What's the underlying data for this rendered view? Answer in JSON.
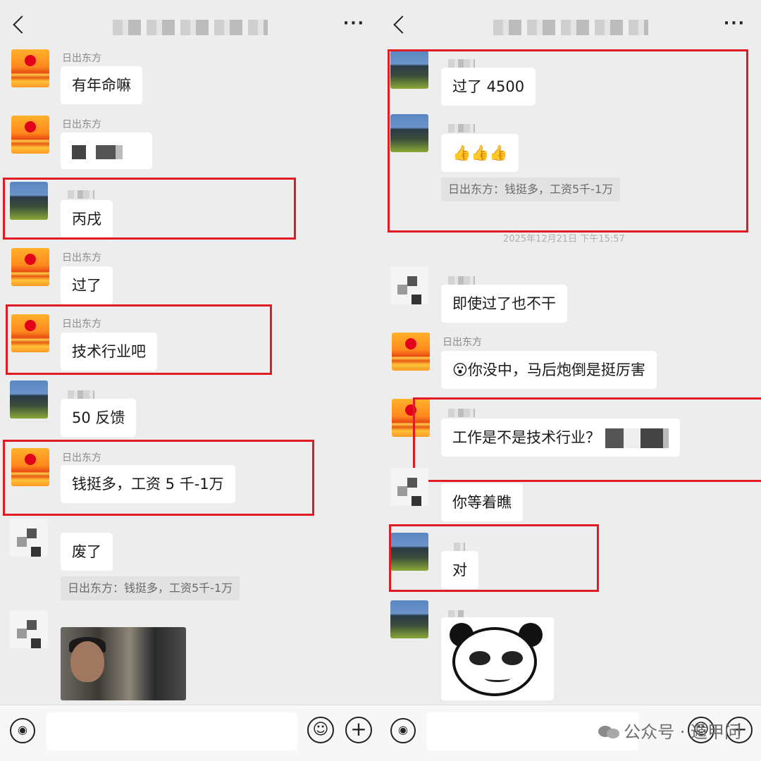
{
  "left_chat": {
    "messages": [
      {
        "sender": "日出东方",
        "text": "有年命嘛"
      },
      {
        "sender": "日出东方",
        "text": ""
      },
      {
        "sender": "",
        "text": "丙戌"
      },
      {
        "sender": "日出东方",
        "text": "过了"
      },
      {
        "sender": "日出东方",
        "text": "技术行业吧"
      },
      {
        "sender": "",
        "text": "50 反馈"
      },
      {
        "sender": "日出东方",
        "text": "钱挺多，工资 5 千-1万"
      },
      {
        "sender": "",
        "text": "废了"
      }
    ],
    "quote": "日出东方：钱挺多，工资5千-1万"
  },
  "right_chat": {
    "messages": [
      {
        "sender": "",
        "text": "过了 4500"
      },
      {
        "sender": "",
        "text": "👍👍👍"
      },
      {
        "sender": "",
        "text": "即使过了也不干"
      },
      {
        "sender": "日出东方",
        "text": "😮你没中，马后炮倒是挺厉害"
      },
      {
        "sender": "",
        "text": "工作是不是技术行业？"
      },
      {
        "sender": "",
        "text": "你等着瞧"
      },
      {
        "sender": "",
        "text": "对"
      }
    ],
    "quote": "日出东方：钱挺多，工资5千-1万",
    "timestamp": "2025年12月21日 下午15:57"
  },
  "icons": {
    "back": "chevron-left-icon",
    "more": "more-dots-icon",
    "voice": "voice-icon",
    "emoji": "emoji-icon",
    "plus": "plus-icon"
  },
  "watermark": "公众号 · 遁甲问"
}
